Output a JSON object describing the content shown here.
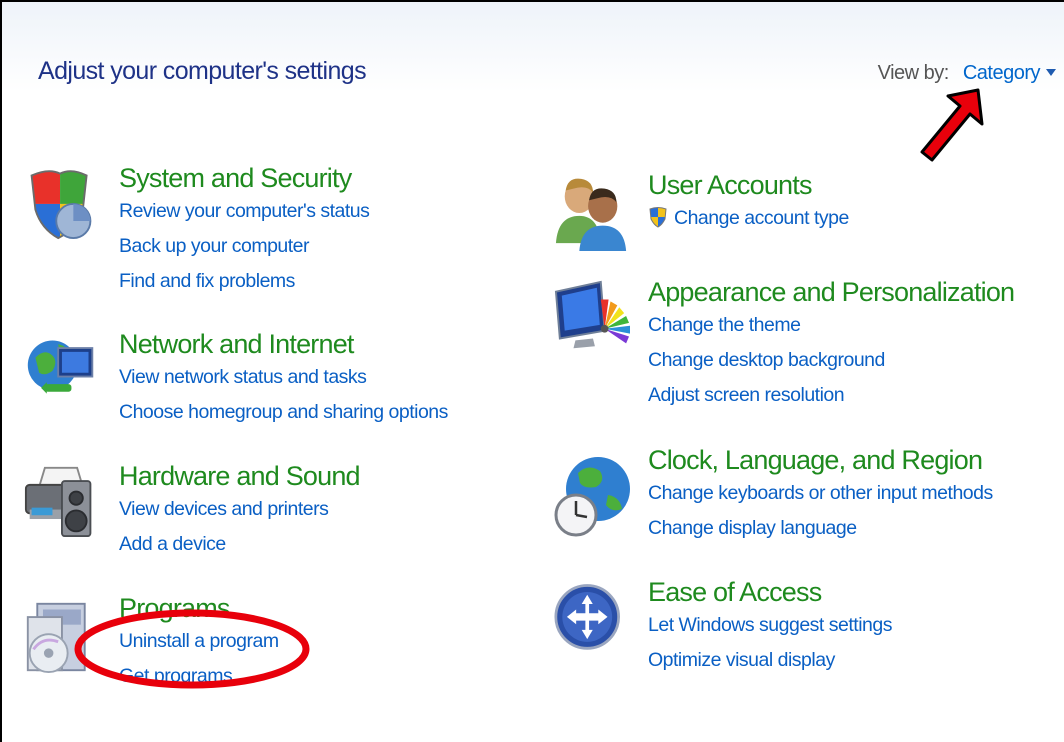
{
  "header": {
    "title": "Adjust your computer's settings",
    "view_by_label": "View by:",
    "view_by_value": "Category"
  },
  "categories_left": [
    {
      "heading": "System and Security",
      "icon": "shield-icon",
      "links": [
        "Review your computer's status",
        "Back up your computer",
        "Find and fix problems"
      ]
    },
    {
      "heading": "Network and Internet",
      "icon": "globe-network-icon",
      "links": [
        "View network status and tasks",
        "Choose homegroup and sharing options"
      ]
    },
    {
      "heading": "Hardware and Sound",
      "icon": "printer-speaker-icon",
      "links": [
        "View devices and printers",
        "Add a device"
      ]
    },
    {
      "heading": "Programs",
      "icon": "programs-disc-icon",
      "links": [
        "Uninstall a program",
        "Get programs"
      ]
    }
  ],
  "categories_right": [
    {
      "heading": "User Accounts",
      "icon": "users-icon",
      "links": [
        "Change account type"
      ]
    },
    {
      "heading": "Appearance and Personalization",
      "icon": "monitor-palette-icon",
      "links": [
        "Change the theme",
        "Change desktop background",
        "Adjust screen resolution"
      ]
    },
    {
      "heading": "Clock, Language, and Region",
      "icon": "globe-clock-icon",
      "links": [
        "Change keyboards or other input methods",
        "Change display language"
      ]
    },
    {
      "heading": "Ease of Access",
      "icon": "ease-of-access-icon",
      "links": [
        "Let Windows suggest settings",
        "Optimize visual display"
      ]
    }
  ],
  "colors": {
    "heading": "#1e8a1e",
    "link": "#0a5fc4",
    "title": "#1e3287",
    "annotation": "#e8000b"
  }
}
